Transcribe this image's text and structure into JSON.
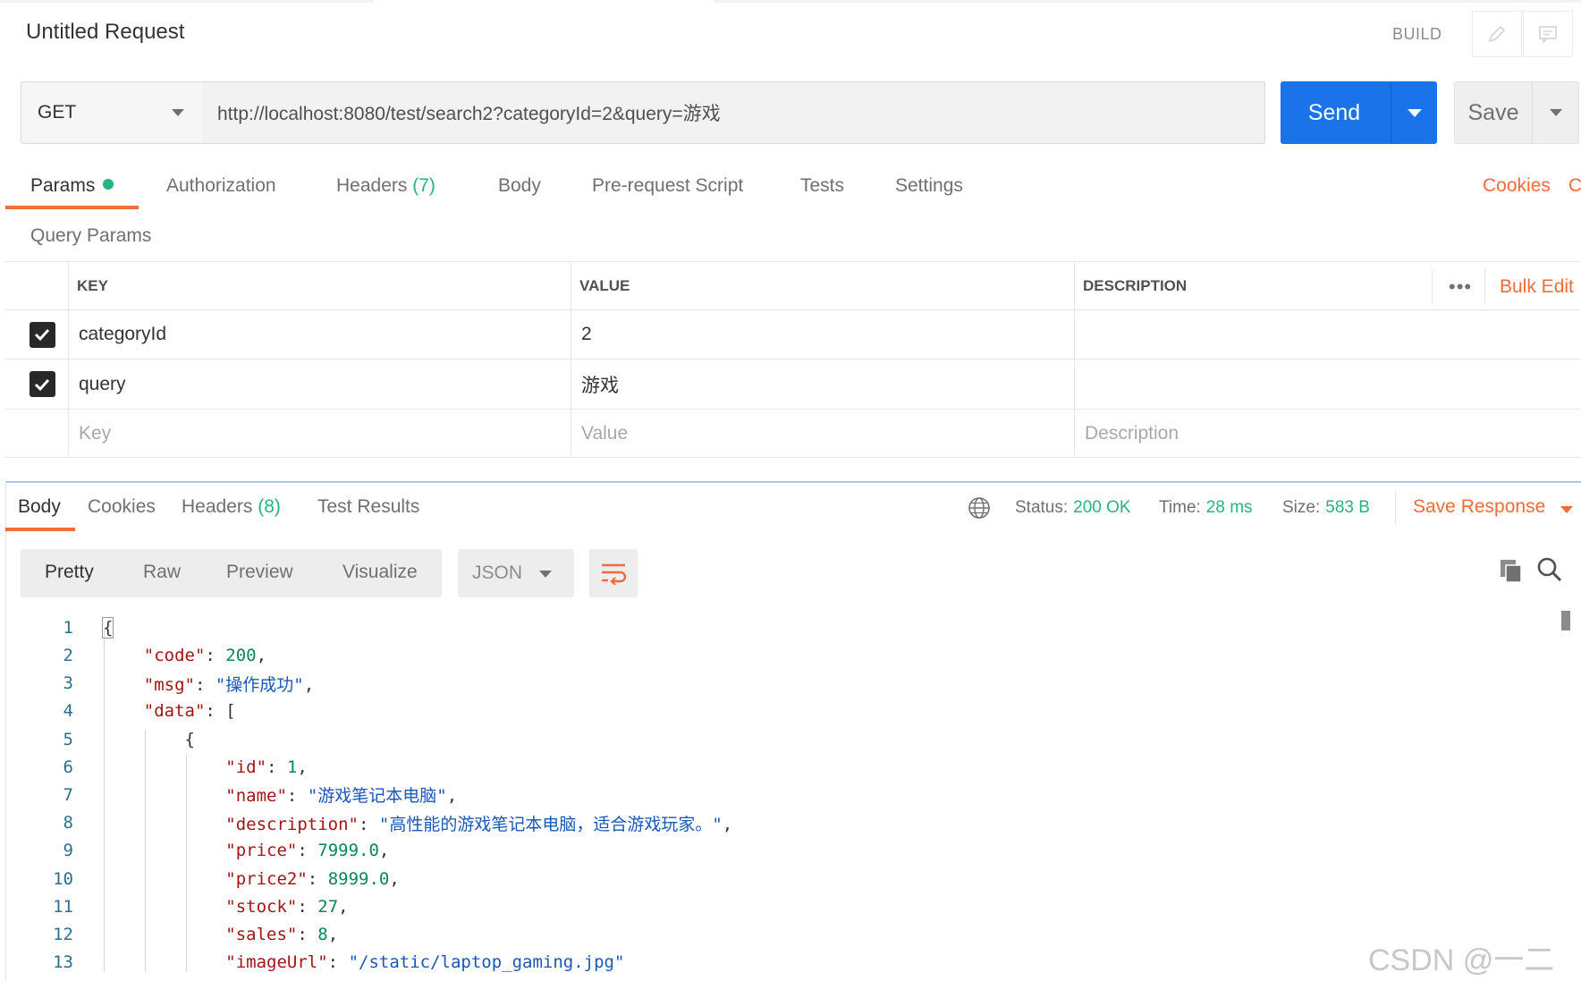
{
  "header": {
    "title": "Untitled Request",
    "build_label": "BUILD",
    "edit_icon": "pencil-icon",
    "comment_icon": "comment-icon"
  },
  "request": {
    "method": "GET",
    "url": "http://localhost:8080/test/search2?categoryId=2&query=游戏",
    "send_label": "Send",
    "save_label": "Save"
  },
  "request_tabs": [
    {
      "label": "Params",
      "active": true,
      "dot": true
    },
    {
      "label": "Authorization"
    },
    {
      "label": "Headers",
      "count": "(7)"
    },
    {
      "label": "Body"
    },
    {
      "label": "Pre-request Script"
    },
    {
      "label": "Tests"
    },
    {
      "label": "Settings"
    }
  ],
  "request_links": {
    "cookies": "Cookies",
    "code": "Code"
  },
  "query_params": {
    "title": "Query Params",
    "headers": {
      "key": "KEY",
      "value": "VALUE",
      "description": "DESCRIPTION"
    },
    "more_label": "•••",
    "bulk_edit": "Bulk Edit",
    "rows": [
      {
        "checked": true,
        "key": "categoryId",
        "value": "2",
        "description": ""
      },
      {
        "checked": true,
        "key": "query",
        "value": "游戏",
        "description": ""
      }
    ],
    "placeholders": {
      "key": "Key",
      "value": "Value",
      "description": "Description"
    }
  },
  "response_tabs": [
    {
      "label": "Body",
      "active": true
    },
    {
      "label": "Cookies"
    },
    {
      "label": "Headers",
      "count": "(8)"
    },
    {
      "label": "Test Results"
    }
  ],
  "response_meta": {
    "status_label": "Status:",
    "status_value": "200 OK",
    "time_label": "Time:",
    "time_value": "28 ms",
    "size_label": "Size:",
    "size_value": "583 B",
    "save_response": "Save Response"
  },
  "view_modes": [
    "Pretty",
    "Raw",
    "Preview",
    "Visualize"
  ],
  "format": "JSON",
  "colors": {
    "accent": "#f26b3a",
    "send": "#1a73e8",
    "success": "#26b47f"
  },
  "code_lines": [
    {
      "n": "1",
      "html": "<span class=\"brace-hl\">{</span>"
    },
    {
      "n": "2",
      "html": "    <span class=\"k\">\"code\"</span>: <span class=\"n\">200</span>,"
    },
    {
      "n": "3",
      "html": "    <span class=\"k\">\"msg\"</span>: <span class=\"s\">\"操作成功\"</span>,"
    },
    {
      "n": "4",
      "html": "    <span class=\"k\">\"data\"</span>: ["
    },
    {
      "n": "5",
      "html": "        {"
    },
    {
      "n": "6",
      "html": "            <span class=\"k\">\"id\"</span>: <span class=\"n\">1</span>,"
    },
    {
      "n": "7",
      "html": "            <span class=\"k\">\"name\"</span>: <span class=\"s\">\"游戏笔记本电脑\"</span>,"
    },
    {
      "n": "8",
      "html": "            <span class=\"k\">\"description\"</span>: <span class=\"s\">\"高性能的游戏笔记本电脑，适合游戏玩家。\"</span>,"
    },
    {
      "n": "9",
      "html": "            <span class=\"k\">\"price\"</span>: <span class=\"n\">7999.0</span>,"
    },
    {
      "n": "10",
      "html": "            <span class=\"k\">\"price2\"</span>: <span class=\"n\">8999.0</span>,"
    },
    {
      "n": "11",
      "html": "            <span class=\"k\">\"stock\"</span>: <span class=\"n\">27</span>,"
    },
    {
      "n": "12",
      "html": "            <span class=\"k\">\"sales\"</span>: <span class=\"n\">8</span>,"
    },
    {
      "n": "13",
      "html": "            <span class=\"k\">\"imageUrl\"</span>: <span class=\"s\">\"/static/laptop_gaming.jpg\"</span>"
    }
  ],
  "watermark": "CSDN @一二"
}
